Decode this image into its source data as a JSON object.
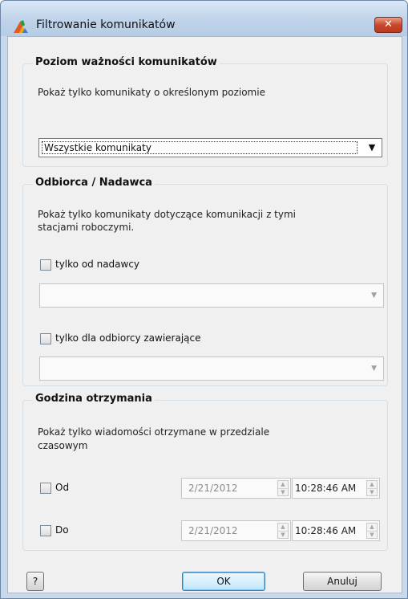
{
  "window": {
    "title": "Filtrowanie komunikatów",
    "close_label": "✕"
  },
  "severity": {
    "group_title": "Poziom ważności komunikatów",
    "description": "Pokaż tylko komunikaty o określonym poziomie",
    "selected_value": "Wszystkie komunikaty",
    "dropdown_arrow": "▼"
  },
  "recipient_sender": {
    "group_title": "Odbiorca / Nadawca",
    "description_line1": "Pokaż tylko komunikaty dotyczące komunikacji z tymi",
    "description_line2": "stacjami roboczymi.",
    "from_sender": {
      "label": "tylko od nadawcy",
      "checked": false,
      "value": ""
    },
    "to_recipient": {
      "label": "tylko dla odbiorcy zawierające",
      "checked": false,
      "value": ""
    },
    "combo_arrow": "▼"
  },
  "received_time": {
    "group_title": "Godzina otrzymania",
    "description_line1": "Pokaż tylko wiadomości otrzymane w przedziale",
    "description_line2": "czasowym",
    "from": {
      "label": "Od",
      "checked": false,
      "date": "2/21/2012",
      "time": "10:28:46 AM"
    },
    "to": {
      "label": "Do",
      "checked": false,
      "date": "2/21/2012",
      "time": "10:28:46 AM"
    },
    "spin_up": "▲",
    "spin_down": "▼"
  },
  "footer": {
    "help_label": "?",
    "ok_label": "OK",
    "cancel_label": "Anuluj"
  }
}
